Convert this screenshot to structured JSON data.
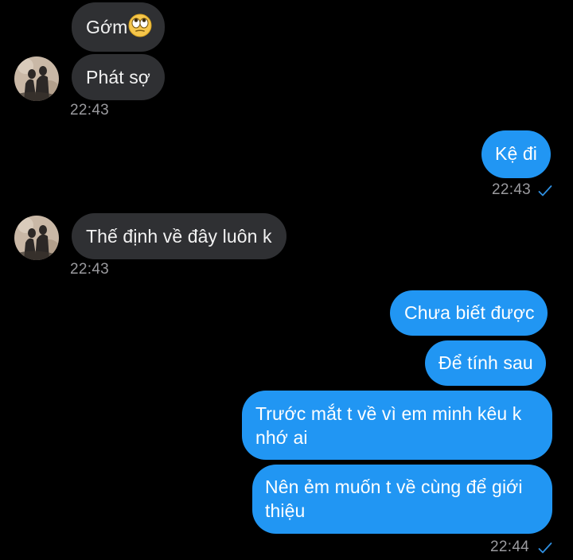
{
  "messages": {
    "m1": {
      "text": "Gớm",
      "emoji": "face-with-rolling-eyes"
    },
    "m2": {
      "text": "Phát sợ"
    },
    "t1": "22:43",
    "m3": {
      "text": "Kệ đi"
    },
    "t2": "22:43",
    "m4": {
      "text": "Thế định về đây luôn k"
    },
    "t3": "22:43",
    "m5": {
      "text": "Chưa biết được"
    },
    "m6": {
      "text": "Để tính sau"
    },
    "m7": {
      "line1": "Trước mắt t về vì em minh kêu k",
      "line2": "nhớ ai"
    },
    "m8": {
      "line1": "Nên ẻm muốn t về cùng để giới",
      "line2": "thiệu"
    },
    "t4": "22:44"
  },
  "icons": {
    "read_check": "check-icon",
    "avatar": "contact-avatar"
  },
  "colors": {
    "outgoing": "#2196f3",
    "incoming": "#2f3033",
    "timestamp": "#9a9a9e",
    "check": "#2f8fe0"
  }
}
